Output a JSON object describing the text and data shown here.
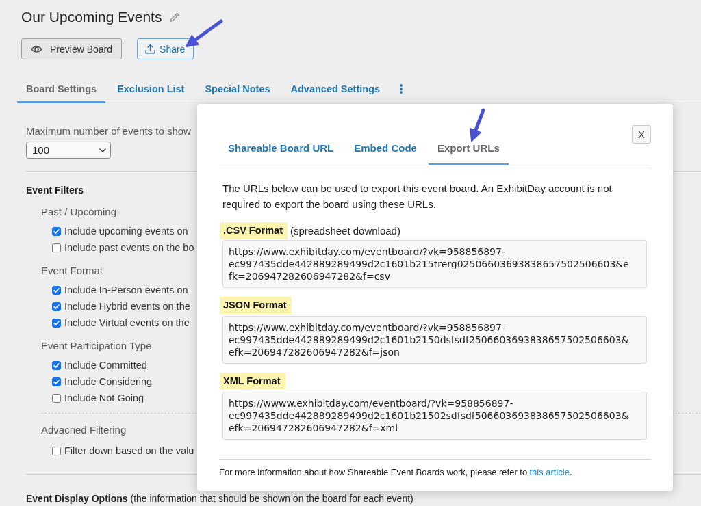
{
  "page": {
    "title": "Our Upcoming Events",
    "actions": [
      {
        "kind": "preview",
        "label": "Preview Board"
      },
      {
        "kind": "share",
        "label": "Share"
      }
    ]
  },
  "tabs": [
    {
      "label": "Board Settings",
      "selected": true
    },
    {
      "label": "Exclusion List",
      "selected": false
    },
    {
      "label": "Special Notes",
      "selected": false
    },
    {
      "label": "Advanced Settings",
      "selected": false
    }
  ],
  "settings": {
    "max_events": {
      "label": "Maximum number of events to show",
      "value": "100"
    },
    "filters": {
      "heading": "Event Filters",
      "groups": [
        {
          "title": "Past / Upcoming",
          "options": [
            {
              "label": "Include upcoming events on",
              "checked": true
            },
            {
              "label": "Include past events on the bo",
              "checked": false
            }
          ]
        },
        {
          "title": "Event Format",
          "options": [
            {
              "label": "Include In-Person events on",
              "checked": true
            },
            {
              "label": "Include Hybrid events on the",
              "checked": true
            },
            {
              "label": "Include Virtual events on the",
              "checked": true
            }
          ]
        },
        {
          "title": "Event Participation Type",
          "options": [
            {
              "label": "Include Committed",
              "checked": true
            },
            {
              "label": "Include Considering",
              "checked": true
            },
            {
              "label": "Include Not Going",
              "checked": false
            }
          ]
        }
      ]
    },
    "advanced": {
      "title": "Advacned Filtering",
      "options": [
        {
          "label": "Filter down based on the valu",
          "checked": false
        }
      ]
    },
    "display_options": "**Event Display Options** (the information that should be shown on the board for each event)"
  },
  "dialog": {
    "close": "X",
    "tabs": [
      {
        "label": "Shareable Board URL",
        "selected": false
      },
      {
        "label": "Embed Code",
        "selected": false
      },
      {
        "label": "Export URLs",
        "selected": true
      }
    ],
    "description": "The URLs below can be used to export this event board. An ExhibitDay account is not required to export the board using these URLs.",
    "exports": [
      {
        "label": ".CSV Format",
        "note": "(spreadsheet download)",
        "url": "https://www.exhibitday.com/eventboard/?vk=958856897-ec997435dde442889289499d2c1601b215trerg02506603693838657502506603&efk=206947282606947282&f=csv"
      },
      {
        "label": "JSON Format",
        "url": "https://www.exhibitday.com/eventboard/?vk=958856897-ec997435dde442889289499d2c1601b2150dsfsdf2506603693838657502506603&efk=206947282606947282&f=json"
      },
      {
        "label": "XML Format",
        "url": "https://wwww.exhibitday.com/eventboard/?vk=958856897-ec997435dde442889289499d2c1601b21502sdfsdf506603693838657502506603&efk=206947282606947282&f=xml"
      }
    ],
    "footer": {
      "text": "For more information about how Shareable Event Boards work, please refer to",
      "link": "this article",
      "end": "."
    }
  }
}
